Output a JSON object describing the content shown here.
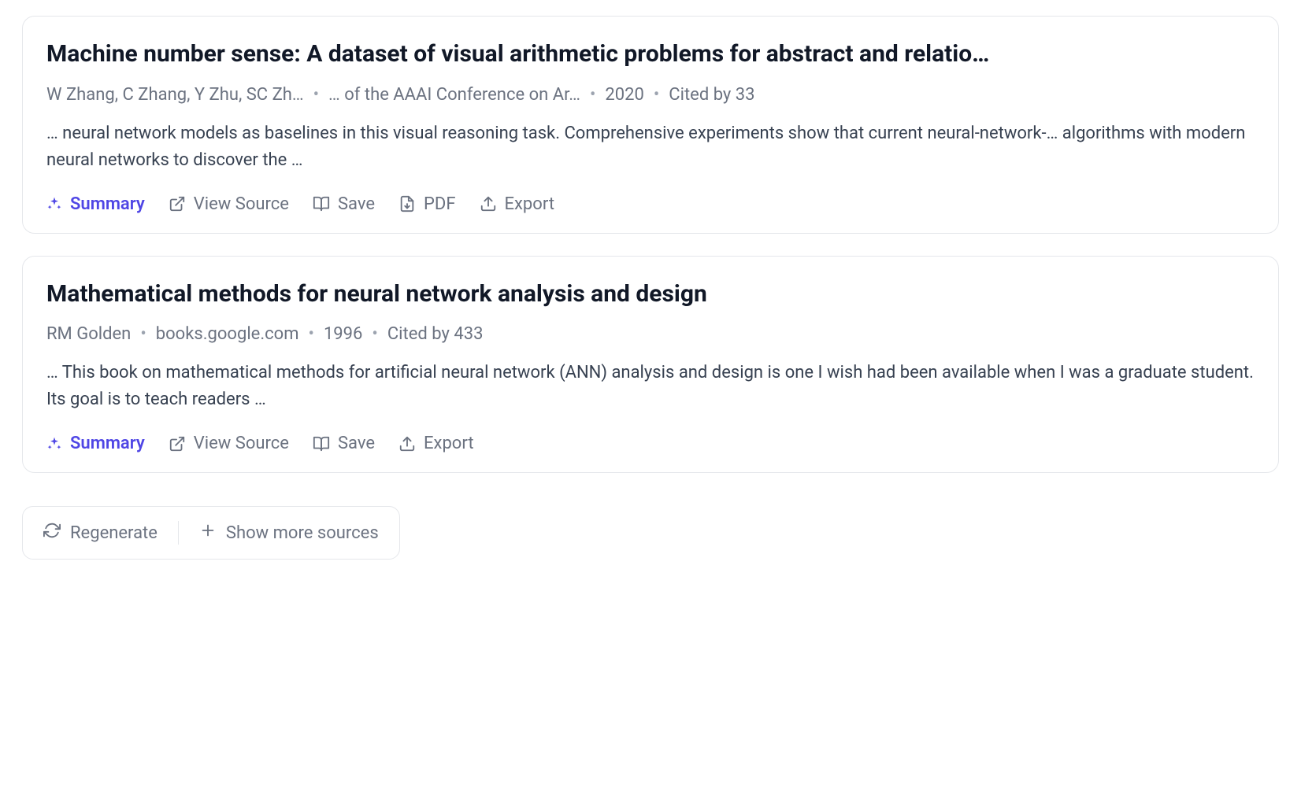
{
  "results": [
    {
      "title": "Machine number sense: A dataset of visual arithmetic problems for abstract and relatio…",
      "authors": "W Zhang, C Zhang, Y Zhu, SC Zh…",
      "venue": "… of the AAAI Conference on Ar…",
      "year": "2020",
      "cited": "Cited by 33",
      "snippet": "… neural network models as baselines in this visual reasoning task. Comprehensive experiments show that current neural-network-… algorithms with modern neural networks to discover the …",
      "has_pdf": true
    },
    {
      "title": "Mathematical methods for neural network analysis and design",
      "authors": "RM Golden",
      "venue": "books.google.com",
      "year": "1996",
      "cited": "Cited by 433",
      "snippet": "… This book on mathematical methods for artificial neural network (ANN) analysis and design is one I wish had been available when I was a graduate student. Its goal is to teach readers …",
      "has_pdf": false
    }
  ],
  "actions": {
    "summary": "Summary",
    "view_source": "View Source",
    "save": "Save",
    "pdf": "PDF",
    "export": "Export"
  },
  "footer": {
    "regenerate": "Regenerate",
    "show_more": "Show more sources"
  }
}
